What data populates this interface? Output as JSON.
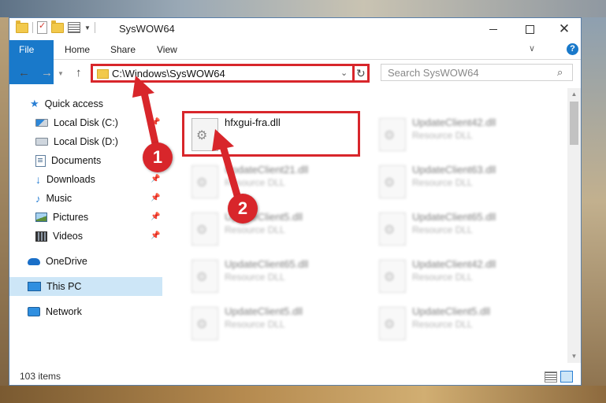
{
  "window": {
    "title": "SysWOW64"
  },
  "ribbon": {
    "tabs": [
      "File",
      "Home",
      "Share",
      "View"
    ]
  },
  "address": {
    "path": "C:\\Windows\\SysWOW64"
  },
  "search": {
    "placeholder": "Search SysWOW64"
  },
  "sidebar": {
    "items": [
      {
        "label": "Quick access",
        "pinned": false
      },
      {
        "label": "Local Disk (C:)",
        "pinned": true
      },
      {
        "label": "Local Disk (D:)",
        "pinned": false
      },
      {
        "label": "Documents",
        "pinned": true
      },
      {
        "label": "Downloads",
        "pinned": true
      },
      {
        "label": "Music",
        "pinned": true
      },
      {
        "label": "Pictures",
        "pinned": true
      },
      {
        "label": "Videos",
        "pinned": true
      },
      {
        "label": "OneDrive",
        "pinned": false
      },
      {
        "label": "This PC",
        "pinned": false,
        "selected": true
      },
      {
        "label": "Network",
        "pinned": false
      }
    ]
  },
  "files": [
    {
      "name": "hfxgui-fra.dll",
      "type": "",
      "highlighted": true
    },
    {
      "name": "UpdateClient42.dll",
      "type": "Resource DLL"
    },
    {
      "name": "UpdateClient21.dll",
      "type": "Resource DLL"
    },
    {
      "name": "UpdateClient63.dll",
      "type": "Resource DLL"
    },
    {
      "name": "UpdateClient5.dll",
      "type": "Resource DLL"
    },
    {
      "name": "UpdateClient65.dll",
      "type": "Resource DLL"
    },
    {
      "name": "UpdateClient65.dll",
      "type": "Resource DLL"
    },
    {
      "name": "UpdateClient42.dll",
      "type": "Resource DLL"
    },
    {
      "name": "UpdateClient5.dll",
      "type": "Resource DLL"
    },
    {
      "name": "UpdateClient5.dll",
      "type": "Resource DLL"
    }
  ],
  "status": {
    "item_count": "103 items"
  },
  "annotations": {
    "step1": "1",
    "step2": "2"
  },
  "colors": {
    "highlight": "#d8262b",
    "accent": "#1979ca",
    "selected": "#cde6f7"
  }
}
